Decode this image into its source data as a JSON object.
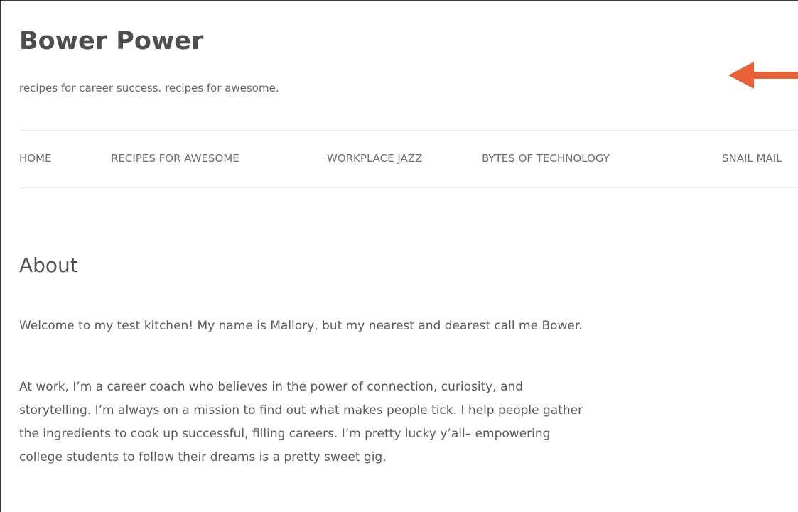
{
  "header": {
    "site_title": "Bower Power",
    "tagline": "recipes for career success. recipes for awesome."
  },
  "nav": {
    "items": [
      {
        "label": "HOME"
      },
      {
        "label": "RECIPES FOR AWESOME"
      },
      {
        "label": "WORKPLACE JAZZ"
      },
      {
        "label": "BYTES OF TECHNOLOGY"
      },
      {
        "label": "SNAIL MAIL"
      }
    ]
  },
  "content": {
    "heading": "About",
    "paragraph_1": "Welcome to my test kitchen! My name is Mallory, but my nearest and dearest call me Bower.",
    "paragraph_2_lines": [
      "At work, I’m a career coach who believes in the power of connection, curiosity, and",
      "storytelling. I’m always on a mission to find out what makes people tick. I help people gather",
      "the ingredients to cook up successful, filling careers. I’m pretty lucky y’all– empowering",
      "college students to follow their dreams is a pretty sweet gig."
    ]
  },
  "colors": {
    "annotation_arrow": "#e8623a",
    "title_text": "#4e4e4e",
    "nav_text": "#6e6e6e",
    "divider": "#ececec"
  },
  "icons": {
    "annotation": "left-arrow-icon"
  }
}
